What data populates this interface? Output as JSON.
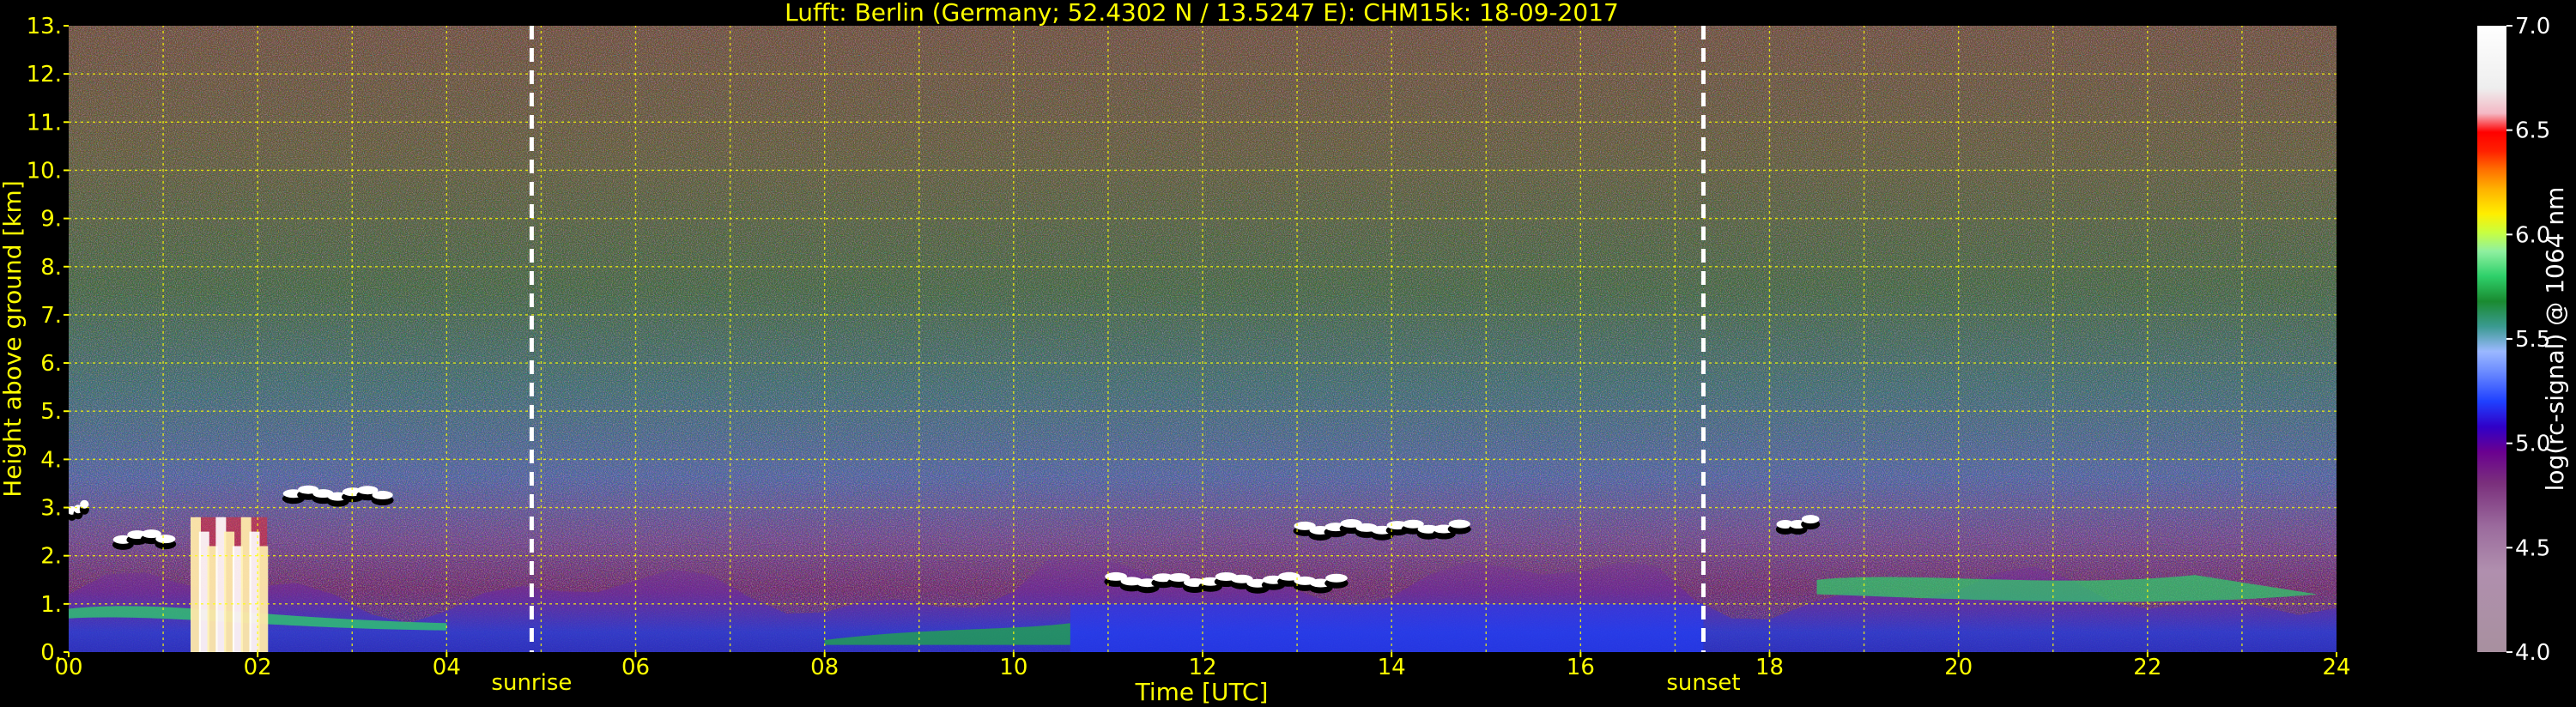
{
  "chart_data": {
    "type": "heatmap",
    "title": "Lufft: Berlin (Germany; 52.4302 N / 13.5247 E):    CHM15k: 18-09-2017",
    "xlabel": "Time [UTC]",
    "ylabel": "Height above ground [km]",
    "xlim": [
      0,
      24
    ],
    "ylim": [
      0,
      13
    ],
    "x_ticks": [
      "00",
      "02",
      "04",
      "06",
      "08",
      "10",
      "12",
      "14",
      "16",
      "18",
      "20",
      "22",
      "24"
    ],
    "y_ticks": [
      "0.",
      "1.",
      "2.",
      "3.",
      "4.",
      "5.",
      "6.",
      "7.",
      "8.",
      "9.",
      "10.",
      "11.",
      "12.",
      "13."
    ],
    "grid": true,
    "grid_color": "#ffff00",
    "colorbar": {
      "label": "log(rc-signal) @ 1064 nm",
      "range": [
        4.0,
        7.0
      ],
      "ticks": [
        "4.0",
        "4.5",
        "5.0",
        "5.5",
        "6.0",
        "6.5",
        "7.0"
      ]
    },
    "annotations": [
      {
        "label": "sunrise",
        "time_utc": 4.9
      },
      {
        "label": "sunset",
        "time_utc": 17.3
      }
    ],
    "features": [
      {
        "name": "boundary layer",
        "time_range_utc": [
          0,
          24
        ],
        "height_km_range": [
          0,
          2.0
        ]
      },
      {
        "name": "cloud layer",
        "time_range_utc": [
          0,
          0.2
        ],
        "height_km": 3.0
      },
      {
        "name": "cloud layer",
        "time_range_utc": [
          0.5,
          1.1
        ],
        "height_km": 2.4
      },
      {
        "name": "cloud layer",
        "time_range_utc": [
          2.3,
          3.4
        ],
        "height_km": 3.3
      },
      {
        "name": "precipitation / low cloud",
        "time_range_utc": [
          1.3,
          2.1
        ],
        "height_km_range": [
          0,
          2.8
        ]
      },
      {
        "name": "cloud layer",
        "time_range_utc": [
          11.0,
          13.5
        ],
        "height_km": 1.5
      },
      {
        "name": "cloud layer",
        "time_range_utc": [
          13.0,
          14.8
        ],
        "height_km": 2.6
      },
      {
        "name": "cloud layer",
        "time_range_utc": [
          18.1,
          18.5
        ],
        "height_km": 2.7
      }
    ]
  },
  "colors": {
    "background": "#000000",
    "text_axis": "#ffff00",
    "text_colorbar": "#ffffff",
    "colorbar_stops": [
      "#a8909f",
      "#a8909f",
      "#b28fb5",
      "#9b6b9d",
      "#7a2f7c",
      "#6a0090",
      "#2d00c0",
      "#2a4bff",
      "#6f8fff",
      "#9bb8ff",
      "#3ab0a0",
      "#1e9a3a",
      "#2ed06a",
      "#6fe08a",
      "#c8ff40",
      "#ffee00",
      "#ffb000",
      "#ff7000",
      "#ff2000",
      "#ff0000",
      "#f4b8c4",
      "#eeeeee",
      "#ffffff"
    ]
  }
}
